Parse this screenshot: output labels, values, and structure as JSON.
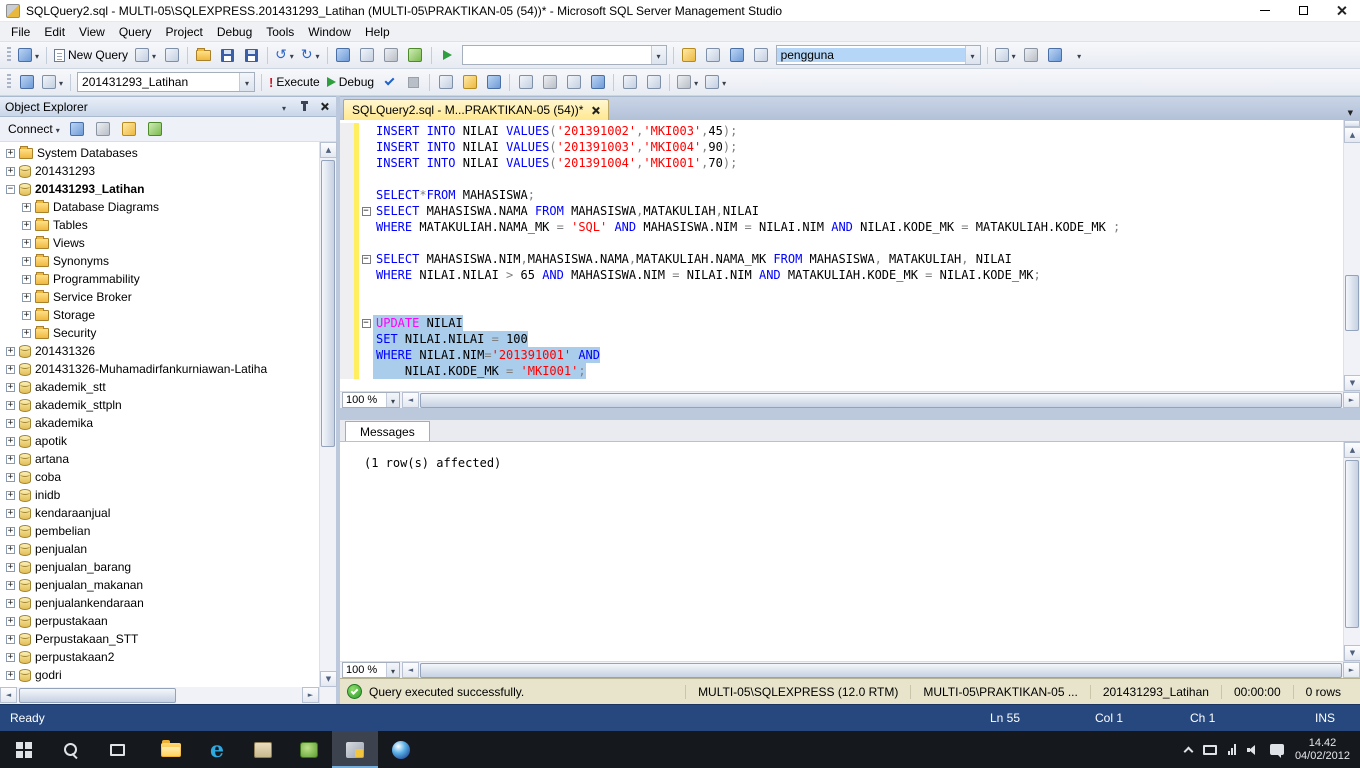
{
  "window": {
    "title": "SQLQuery2.sql - MULTI-05\\SQLEXPRESS.201431293_Latihan (MULTI-05\\PRAKTIKAN-05 (54))* - Microsoft SQL Server Management Studio"
  },
  "menu": {
    "items": [
      "File",
      "Edit",
      "View",
      "Query",
      "Project",
      "Debug",
      "Tools",
      "Window",
      "Help"
    ]
  },
  "toolbar1": {
    "new_query_label": "New Query",
    "combo_value": "",
    "find_combo_value": "pengguna"
  },
  "toolbar2": {
    "database_combo_value": "201431293_Latihan",
    "execute_label": "Execute",
    "debug_label": "Debug"
  },
  "object_explorer": {
    "title": "Object Explorer",
    "connect_label": "Connect",
    "tree": [
      {
        "l": "System Databases",
        "v": 1,
        "e": "+",
        "i": "folder"
      },
      {
        "l": "201431293",
        "v": 1,
        "e": "+",
        "i": "db"
      },
      {
        "l": "201431293_Latihan",
        "v": 1,
        "e": "-",
        "i": "db",
        "b": 1
      },
      {
        "l": "Database Diagrams",
        "v": 2,
        "e": "+",
        "i": "folder"
      },
      {
        "l": "Tables",
        "v": 2,
        "e": "+",
        "i": "folder"
      },
      {
        "l": "Views",
        "v": 2,
        "e": "+",
        "i": "folder"
      },
      {
        "l": "Synonyms",
        "v": 2,
        "e": "+",
        "i": "folder"
      },
      {
        "l": "Programmability",
        "v": 2,
        "e": "+",
        "i": "folder"
      },
      {
        "l": "Service Broker",
        "v": 2,
        "e": "+",
        "i": "folder"
      },
      {
        "l": "Storage",
        "v": 2,
        "e": "+",
        "i": "folder"
      },
      {
        "l": "Security",
        "v": 2,
        "e": "+",
        "i": "folder"
      },
      {
        "l": "201431326",
        "v": 1,
        "e": "+",
        "i": "db"
      },
      {
        "l": "201431326-Muhamadirfankurniawan-Latiha",
        "v": 1,
        "e": "+",
        "i": "db"
      },
      {
        "l": "akademik_stt",
        "v": 1,
        "e": "+",
        "i": "db"
      },
      {
        "l": "akademik_sttpln",
        "v": 1,
        "e": "+",
        "i": "db"
      },
      {
        "l": "akademika",
        "v": 1,
        "e": "+",
        "i": "db"
      },
      {
        "l": "apotik",
        "v": 1,
        "e": "+",
        "i": "db"
      },
      {
        "l": "artana",
        "v": 1,
        "e": "+",
        "i": "db"
      },
      {
        "l": "coba",
        "v": 1,
        "e": "+",
        "i": "db"
      },
      {
        "l": "inidb",
        "v": 1,
        "e": "+",
        "i": "db"
      },
      {
        "l": "kendaraanjual",
        "v": 1,
        "e": "+",
        "i": "db"
      },
      {
        "l": "pembelian",
        "v": 1,
        "e": "+",
        "i": "db"
      },
      {
        "l": "penjualan",
        "v": 1,
        "e": "+",
        "i": "db"
      },
      {
        "l": "penjualan_barang",
        "v": 1,
        "e": "+",
        "i": "db"
      },
      {
        "l": "penjualan_makanan",
        "v": 1,
        "e": "+",
        "i": "db"
      },
      {
        "l": "penjualankendaraan",
        "v": 1,
        "e": "+",
        "i": "db"
      },
      {
        "l": "perpustakaan",
        "v": 1,
        "e": "+",
        "i": "db"
      },
      {
        "l": "Perpustakaan_STT",
        "v": 1,
        "e": "+",
        "i": "db"
      },
      {
        "l": "perpustakaan2",
        "v": 1,
        "e": "+",
        "i": "db"
      },
      {
        "l": "godri",
        "v": 1,
        "e": "+",
        "i": "db"
      }
    ]
  },
  "editor": {
    "tab_title": "SQLQuery2.sql - M...PRAKTIKAN-05 (54))*",
    "zoom": "100 %",
    "lines": [
      {
        "tk": [
          [
            "k",
            "INSERT INTO"
          ],
          [
            "t",
            " NILAI "
          ],
          [
            "k",
            "VALUES"
          ],
          [
            "o",
            "("
          ],
          [
            "s",
            "'201391002'"
          ],
          [
            "o",
            ","
          ],
          [
            "s",
            "'MKI003'"
          ],
          [
            "o",
            ","
          ],
          [
            "t",
            "45"
          ],
          [
            "o",
            ");"
          ]
        ]
      },
      {
        "tk": [
          [
            "k",
            "INSERT INTO"
          ],
          [
            "t",
            " NILAI "
          ],
          [
            "k",
            "VALUES"
          ],
          [
            "o",
            "("
          ],
          [
            "s",
            "'201391003'"
          ],
          [
            "o",
            ","
          ],
          [
            "s",
            "'MKI004'"
          ],
          [
            "o",
            ","
          ],
          [
            "t",
            "90"
          ],
          [
            "o",
            ");"
          ]
        ]
      },
      {
        "tk": [
          [
            "k",
            "INSERT INTO"
          ],
          [
            "t",
            " NILAI "
          ],
          [
            "k",
            "VALUES"
          ],
          [
            "o",
            "("
          ],
          [
            "s",
            "'201391004'"
          ],
          [
            "o",
            ","
          ],
          [
            "s",
            "'MKI001'"
          ],
          [
            "o",
            ","
          ],
          [
            "t",
            "70"
          ],
          [
            "o",
            ");"
          ]
        ]
      },
      {
        "tk": []
      },
      {
        "tk": [
          [
            "k",
            "SELECT"
          ],
          [
            "o",
            "*"
          ],
          [
            "k",
            "FROM"
          ],
          [
            "t",
            " MAHASISWA"
          ],
          [
            "o",
            ";"
          ]
        ]
      },
      {
        "f": 1,
        "tk": [
          [
            "k",
            "SELECT"
          ],
          [
            "t",
            " MAHASISWA.NAMA "
          ],
          [
            "k",
            "FROM"
          ],
          [
            "t",
            " MAHASISWA"
          ],
          [
            "o",
            ","
          ],
          [
            "t",
            "MATAKULIAH"
          ],
          [
            "o",
            ","
          ],
          [
            "t",
            "NILAI"
          ]
        ]
      },
      {
        "tk": [
          [
            "k",
            "WHERE"
          ],
          [
            "t",
            " MATAKULIAH.NAMA_MK "
          ],
          [
            "o",
            "="
          ],
          [
            "t",
            " "
          ],
          [
            "s",
            "'SQL'"
          ],
          [
            "t",
            " "
          ],
          [
            "k",
            "AND"
          ],
          [
            "t",
            " MAHASISWA.NIM "
          ],
          [
            "o",
            "="
          ],
          [
            "t",
            " NILAI.NIM "
          ],
          [
            "k",
            "AND"
          ],
          [
            "t",
            " NILAI.KODE_MK "
          ],
          [
            "o",
            "="
          ],
          [
            "t",
            " MATAKULIAH.KODE_MK "
          ],
          [
            "o",
            ";"
          ]
        ]
      },
      {
        "tk": []
      },
      {
        "f": 1,
        "tk": [
          [
            "k",
            "SELECT"
          ],
          [
            "t",
            " MAHASISWA.NIM"
          ],
          [
            "o",
            ","
          ],
          [
            "t",
            "MAHASISWA.NAMA"
          ],
          [
            "o",
            ","
          ],
          [
            "t",
            "MATAKULIAH.NAMA_MK "
          ],
          [
            "k",
            "FROM"
          ],
          [
            "t",
            " MAHASISWA"
          ],
          [
            "o",
            ","
          ],
          [
            "t",
            " MATAKULIAH"
          ],
          [
            "o",
            ","
          ],
          [
            "t",
            " NILAI"
          ]
        ]
      },
      {
        "tk": [
          [
            "k",
            "WHERE"
          ],
          [
            "t",
            " NILAI.NILAI "
          ],
          [
            "o",
            ">"
          ],
          [
            "t",
            " 65 "
          ],
          [
            "k",
            "AND"
          ],
          [
            "t",
            " MAHASISWA.NIM "
          ],
          [
            "o",
            "="
          ],
          [
            "t",
            " NILAI.NIM "
          ],
          [
            "k",
            "AND"
          ],
          [
            "t",
            " MATAKULIAH.KODE_MK "
          ],
          [
            "o",
            "="
          ],
          [
            "t",
            " NILAI.KODE_MK"
          ],
          [
            "o",
            ";"
          ]
        ]
      },
      {
        "tk": []
      },
      {
        "tk": []
      },
      {
        "f": 1,
        "s": 1,
        "tk": [
          [
            "m",
            "UPDATE"
          ],
          [
            "t",
            " NILAI"
          ]
        ]
      },
      {
        "s": 1,
        "tk": [
          [
            "k",
            "SET"
          ],
          [
            "t",
            " NILAI.NILAI "
          ],
          [
            "o",
            "="
          ],
          [
            "t",
            " 100"
          ]
        ]
      },
      {
        "s": 1,
        "tk": [
          [
            "k",
            "WHERE"
          ],
          [
            "t",
            " NILAI.NIM"
          ],
          [
            "o",
            "="
          ],
          [
            "s",
            "'201391001'"
          ],
          [
            "t",
            " "
          ],
          [
            "k",
            "AND"
          ]
        ]
      },
      {
        "s": 1,
        "tk": [
          [
            "t",
            "    NILAI.KODE_MK "
          ],
          [
            "o",
            "="
          ],
          [
            "t",
            " "
          ],
          [
            "s",
            "'MKI001'"
          ],
          [
            "o",
            ";"
          ]
        ]
      }
    ]
  },
  "messages": {
    "tab_label": "Messages",
    "text": "(1 row(s) affected)",
    "zoom": "100 %"
  },
  "query_status": {
    "message": "Query executed successfully.",
    "server": "MULTI-05\\SQLEXPRESS (12.0 RTM)",
    "user": "MULTI-05\\PRAKTIKAN-05 ...",
    "database": "201431293_Latihan",
    "time": "00:00:00",
    "rows": "0 rows"
  },
  "status_bar": {
    "ready": "Ready",
    "line": "Ln 55",
    "col": "Col 1",
    "ch": "Ch 1",
    "mode": "INS"
  },
  "taskbar": {
    "clock_time": "14.42",
    "clock_date": "04/02/2012"
  },
  "colors": {
    "keyword": "#0000ff",
    "string": "#ff0000",
    "operator": "#7f7f7f",
    "system_object": "#ff00ff",
    "selection": "#a9cdeb",
    "change_bar": "#ffee5f",
    "active_tab": "#ffe88f",
    "query_status_bg": "#e7e4cb",
    "status_bar_bg": "#26487e",
    "success_green": "#2d9c2d"
  }
}
